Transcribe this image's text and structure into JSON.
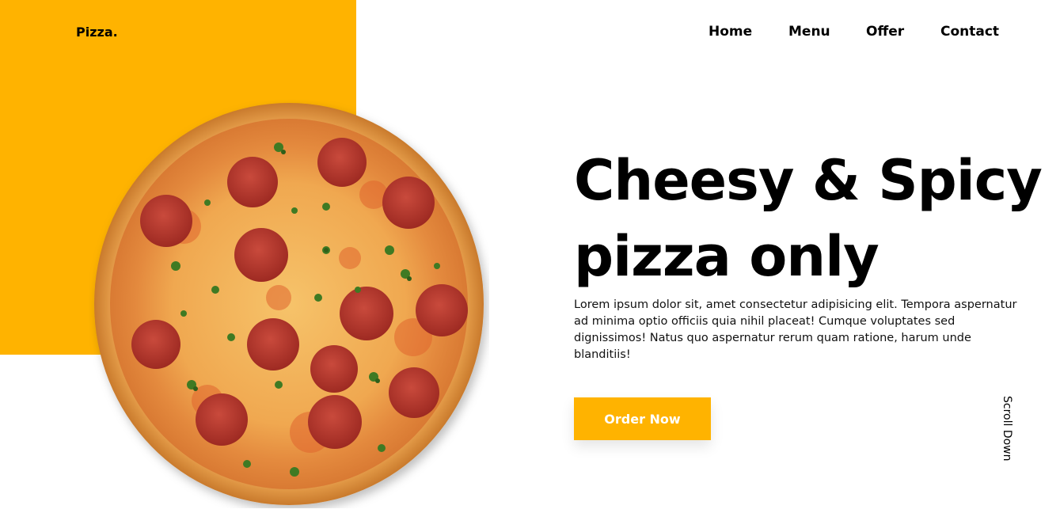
{
  "brand": {
    "logo": "Pizza.",
    "accent_color": "#ffb300"
  },
  "nav": {
    "items": [
      {
        "label": "Home"
      },
      {
        "label": "Menu"
      },
      {
        "label": "Offer"
      },
      {
        "label": "Contact"
      }
    ]
  },
  "hero": {
    "title_line1": "Cheesy & Spicy",
    "title_line2": "pizza only",
    "description": "Lorem ipsum dolor sit, amet consectetur adipisicing elit. Tempora aspernatur ad minima optio officiis quia nihil placeat! Cumque voluptates sed dignissimos! Natus quo aspernatur rerum quam ratione, harum unde blanditiis!",
    "cta_label": "Order Now",
    "image_icon": "pepperoni-pizza-image"
  },
  "scroll_label": "Scroll Down"
}
